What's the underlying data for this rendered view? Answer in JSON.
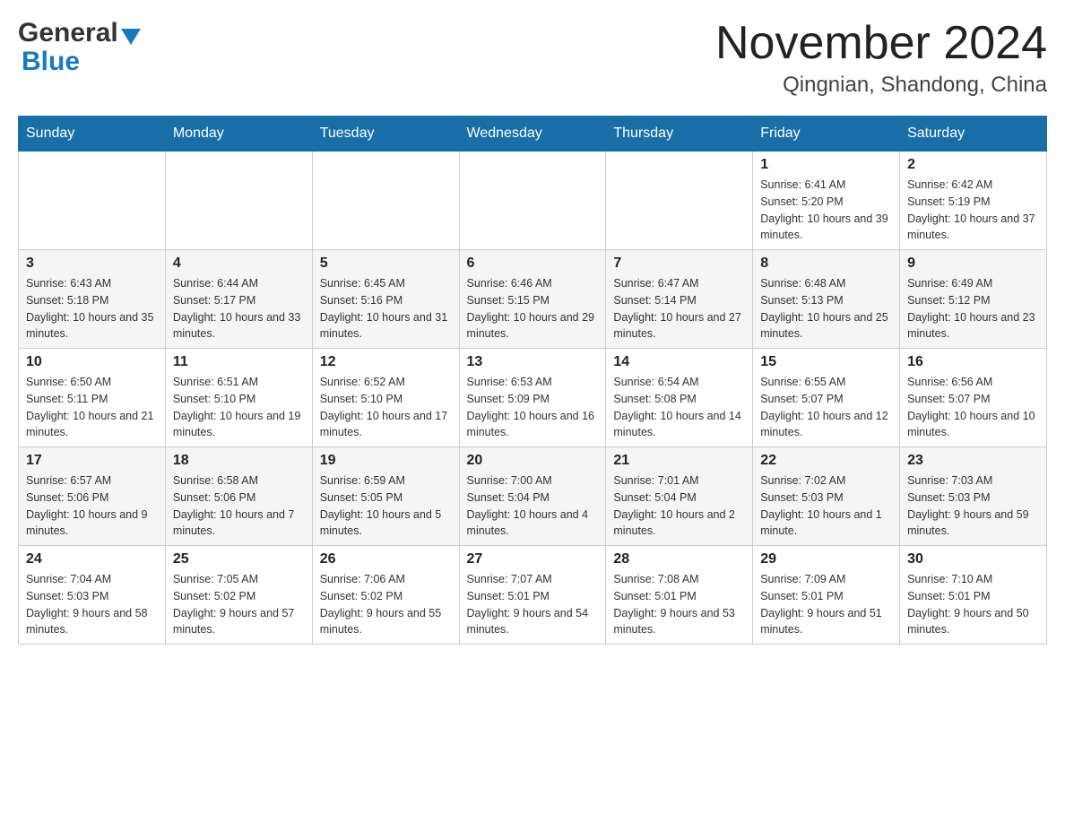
{
  "header": {
    "logo": {
      "general": "General",
      "blue": "Blue"
    },
    "title": "November 2024",
    "location": "Qingnian, Shandong, China"
  },
  "calendar": {
    "days_of_week": [
      "Sunday",
      "Monday",
      "Tuesday",
      "Wednesday",
      "Thursday",
      "Friday",
      "Saturday"
    ],
    "weeks": [
      {
        "days": [
          {
            "number": "",
            "info": ""
          },
          {
            "number": "",
            "info": ""
          },
          {
            "number": "",
            "info": ""
          },
          {
            "number": "",
            "info": ""
          },
          {
            "number": "",
            "info": ""
          },
          {
            "number": "1",
            "info": "Sunrise: 6:41 AM\nSunset: 5:20 PM\nDaylight: 10 hours and 39 minutes."
          },
          {
            "number": "2",
            "info": "Sunrise: 6:42 AM\nSunset: 5:19 PM\nDaylight: 10 hours and 37 minutes."
          }
        ]
      },
      {
        "days": [
          {
            "number": "3",
            "info": "Sunrise: 6:43 AM\nSunset: 5:18 PM\nDaylight: 10 hours and 35 minutes."
          },
          {
            "number": "4",
            "info": "Sunrise: 6:44 AM\nSunset: 5:17 PM\nDaylight: 10 hours and 33 minutes."
          },
          {
            "number": "5",
            "info": "Sunrise: 6:45 AM\nSunset: 5:16 PM\nDaylight: 10 hours and 31 minutes."
          },
          {
            "number": "6",
            "info": "Sunrise: 6:46 AM\nSunset: 5:15 PM\nDaylight: 10 hours and 29 minutes."
          },
          {
            "number": "7",
            "info": "Sunrise: 6:47 AM\nSunset: 5:14 PM\nDaylight: 10 hours and 27 minutes."
          },
          {
            "number": "8",
            "info": "Sunrise: 6:48 AM\nSunset: 5:13 PM\nDaylight: 10 hours and 25 minutes."
          },
          {
            "number": "9",
            "info": "Sunrise: 6:49 AM\nSunset: 5:12 PM\nDaylight: 10 hours and 23 minutes."
          }
        ]
      },
      {
        "days": [
          {
            "number": "10",
            "info": "Sunrise: 6:50 AM\nSunset: 5:11 PM\nDaylight: 10 hours and 21 minutes."
          },
          {
            "number": "11",
            "info": "Sunrise: 6:51 AM\nSunset: 5:10 PM\nDaylight: 10 hours and 19 minutes."
          },
          {
            "number": "12",
            "info": "Sunrise: 6:52 AM\nSunset: 5:10 PM\nDaylight: 10 hours and 17 minutes."
          },
          {
            "number": "13",
            "info": "Sunrise: 6:53 AM\nSunset: 5:09 PM\nDaylight: 10 hours and 16 minutes."
          },
          {
            "number": "14",
            "info": "Sunrise: 6:54 AM\nSunset: 5:08 PM\nDaylight: 10 hours and 14 minutes."
          },
          {
            "number": "15",
            "info": "Sunrise: 6:55 AM\nSunset: 5:07 PM\nDaylight: 10 hours and 12 minutes."
          },
          {
            "number": "16",
            "info": "Sunrise: 6:56 AM\nSunset: 5:07 PM\nDaylight: 10 hours and 10 minutes."
          }
        ]
      },
      {
        "days": [
          {
            "number": "17",
            "info": "Sunrise: 6:57 AM\nSunset: 5:06 PM\nDaylight: 10 hours and 9 minutes."
          },
          {
            "number": "18",
            "info": "Sunrise: 6:58 AM\nSunset: 5:06 PM\nDaylight: 10 hours and 7 minutes."
          },
          {
            "number": "19",
            "info": "Sunrise: 6:59 AM\nSunset: 5:05 PM\nDaylight: 10 hours and 5 minutes."
          },
          {
            "number": "20",
            "info": "Sunrise: 7:00 AM\nSunset: 5:04 PM\nDaylight: 10 hours and 4 minutes."
          },
          {
            "number": "21",
            "info": "Sunrise: 7:01 AM\nSunset: 5:04 PM\nDaylight: 10 hours and 2 minutes."
          },
          {
            "number": "22",
            "info": "Sunrise: 7:02 AM\nSunset: 5:03 PM\nDaylight: 10 hours and 1 minute."
          },
          {
            "number": "23",
            "info": "Sunrise: 7:03 AM\nSunset: 5:03 PM\nDaylight: 9 hours and 59 minutes."
          }
        ]
      },
      {
        "days": [
          {
            "number": "24",
            "info": "Sunrise: 7:04 AM\nSunset: 5:03 PM\nDaylight: 9 hours and 58 minutes."
          },
          {
            "number": "25",
            "info": "Sunrise: 7:05 AM\nSunset: 5:02 PM\nDaylight: 9 hours and 57 minutes."
          },
          {
            "number": "26",
            "info": "Sunrise: 7:06 AM\nSunset: 5:02 PM\nDaylight: 9 hours and 55 minutes."
          },
          {
            "number": "27",
            "info": "Sunrise: 7:07 AM\nSunset: 5:01 PM\nDaylight: 9 hours and 54 minutes."
          },
          {
            "number": "28",
            "info": "Sunrise: 7:08 AM\nSunset: 5:01 PM\nDaylight: 9 hours and 53 minutes."
          },
          {
            "number": "29",
            "info": "Sunrise: 7:09 AM\nSunset: 5:01 PM\nDaylight: 9 hours and 51 minutes."
          },
          {
            "number": "30",
            "info": "Sunrise: 7:10 AM\nSunset: 5:01 PM\nDaylight: 9 hours and 50 minutes."
          }
        ]
      }
    ]
  }
}
